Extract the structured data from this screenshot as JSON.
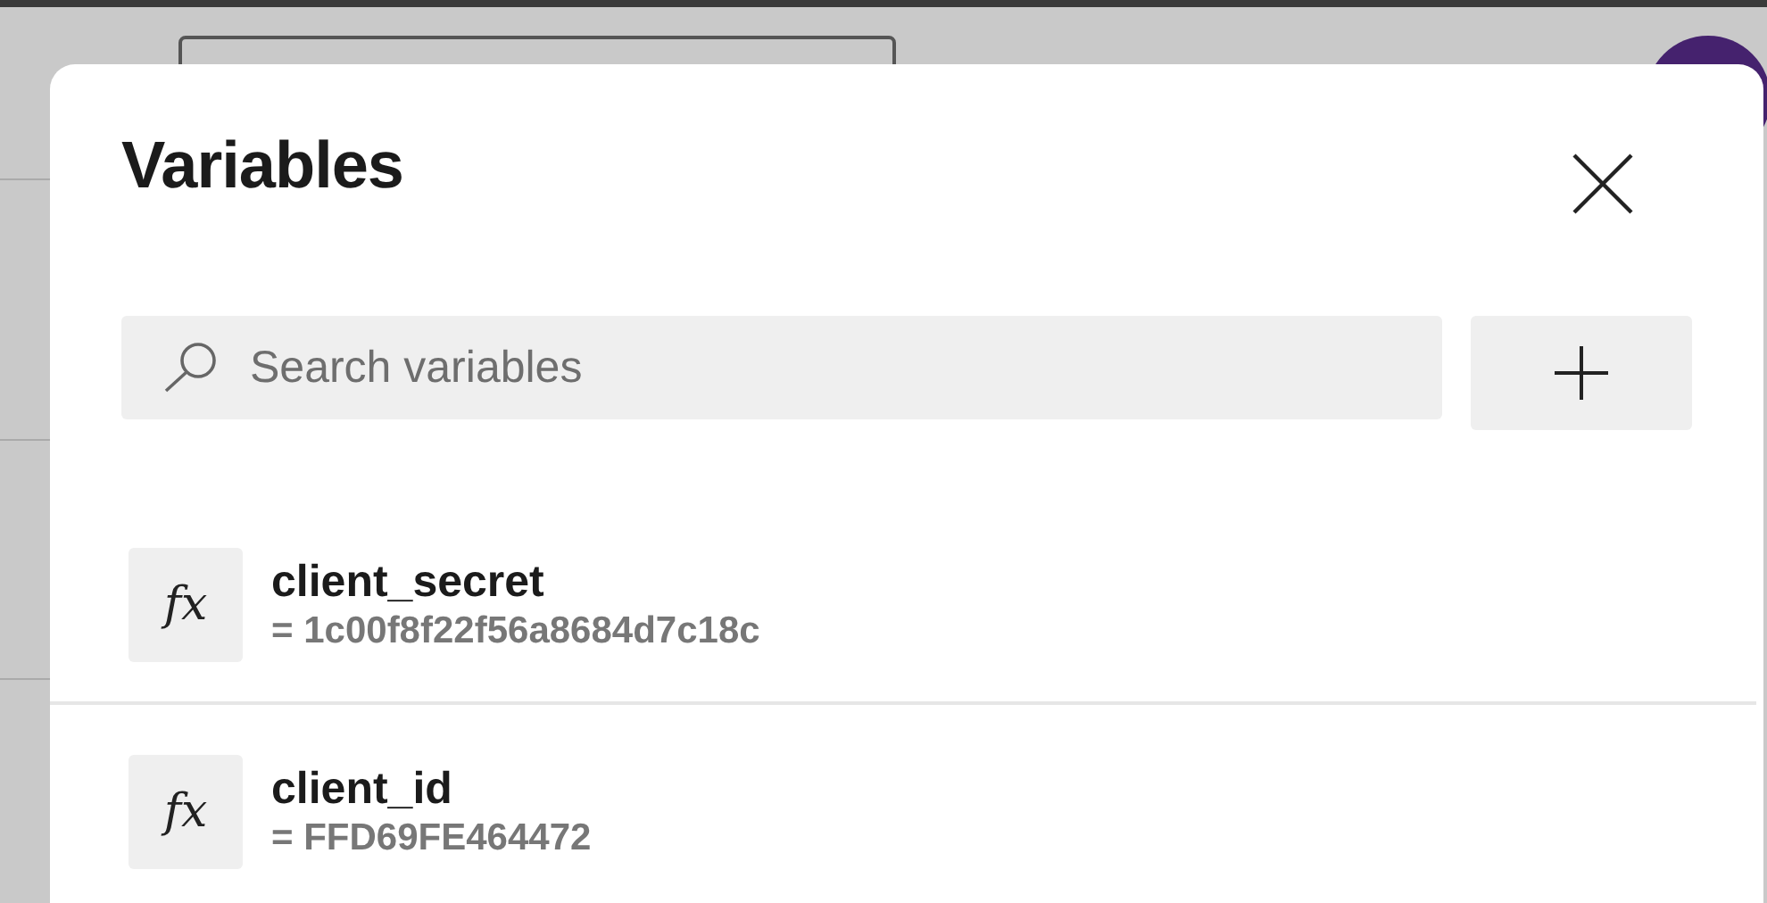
{
  "dialog": {
    "title": "Variables",
    "search": {
      "placeholder": "Search variables"
    },
    "variables": [
      {
        "icon_text": "fx",
        "name": "client_secret",
        "value": "= 1c00f8f22f56a8684d7c18c"
      },
      {
        "icon_text": "fx",
        "name": "client_id",
        "value": "= FFD69FE464472"
      }
    ]
  }
}
